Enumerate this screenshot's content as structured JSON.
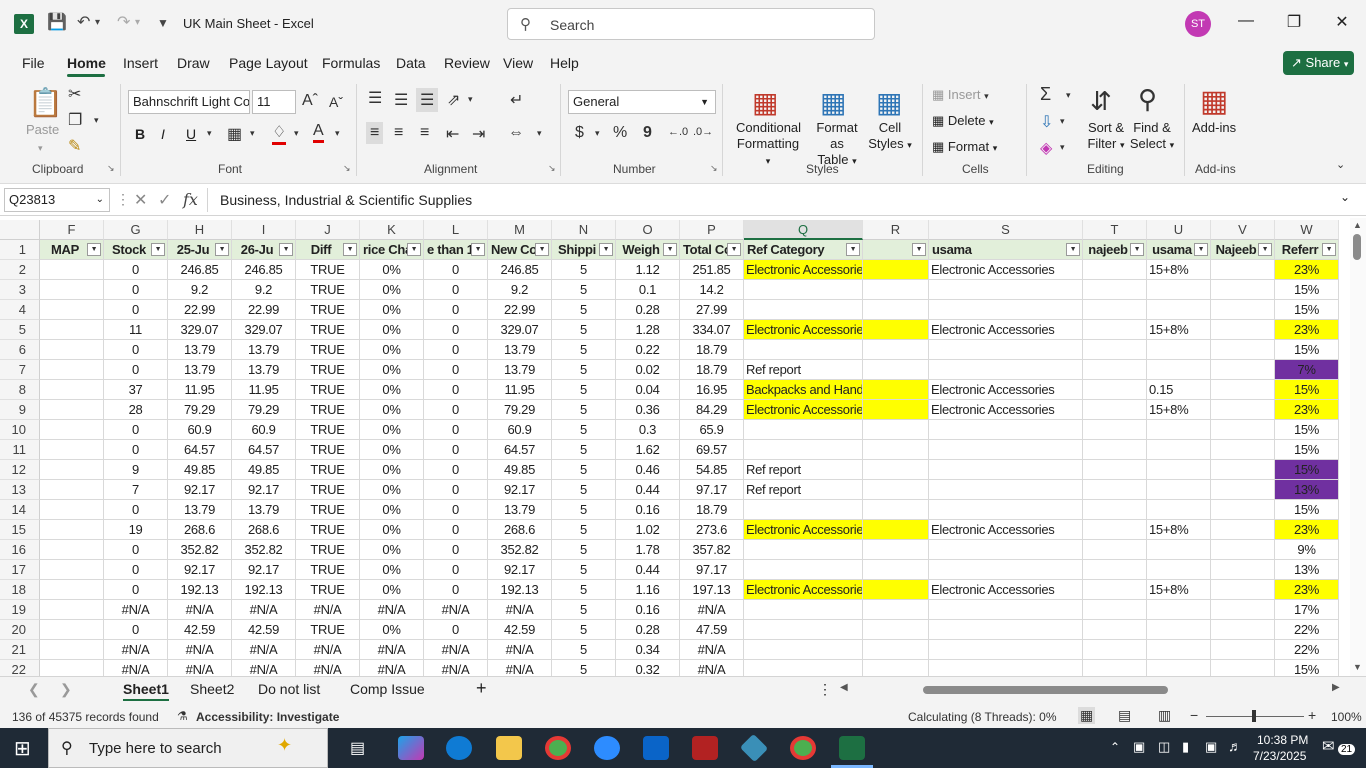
{
  "app": {
    "title": "UK Main Sheet  -  Excel",
    "search_placeholder": "Search",
    "user_initials": "ST",
    "logo": "X"
  },
  "menu": {
    "items": [
      "File",
      "Home",
      "Insert",
      "Draw",
      "Page Layout",
      "Formulas",
      "Data",
      "Review",
      "View",
      "Help"
    ],
    "active": "Home",
    "share_label": "Share"
  },
  "ribbon": {
    "clipboard": {
      "label": "Clipboard",
      "paste": "Paste"
    },
    "font": {
      "label": "Font",
      "font_name": "Bahnschrift Light Co",
      "font_size": "11",
      "bold": "B",
      "italic": "I",
      "underline": "U"
    },
    "alignment": {
      "label": "Alignment"
    },
    "number": {
      "label": "Number",
      "format": "General",
      "currency": "$",
      "percent": "%",
      "comma": "9"
    },
    "styles": {
      "label": "Styles",
      "conditional": "Conditional",
      "conditional2": "Formatting",
      "format_as": "Format as",
      "format_as2": "Table",
      "cell": "Cell",
      "cell2": "Styles"
    },
    "cells": {
      "label": "Cells",
      "insert": "Insert",
      "delete": "Delete",
      "format": "Format"
    },
    "editing": {
      "label": "Editing",
      "sort": "Sort &",
      "sort2": "Filter",
      "find": "Find &",
      "find2": "Select"
    },
    "addins": {
      "label": "Add-ins",
      "button": "Add-ins"
    }
  },
  "formula_bar": {
    "name_box": "Q23813",
    "fx": "fx",
    "value": "Business, Industrial & Scientific Supplies"
  },
  "columns": [
    "F",
    "G",
    "H",
    "I",
    "J",
    "K",
    "L",
    "M",
    "N",
    "O",
    "P",
    "Q",
    "R",
    "S",
    "T",
    "U",
    "V",
    "W"
  ],
  "header_row": [
    "MAP",
    "Stock",
    "25-Ju",
    "26-Ju",
    "Diff",
    "rice Cha",
    "e than 1",
    "New Co",
    "Shippi",
    "Weigh",
    "Total Co",
    "Ref Category",
    "",
    "usama",
    "najeeb",
    "usama",
    "Najeeb",
    "Referr"
  ],
  "rows": [
    {
      "n": "2",
      "cells": [
        "",
        "0",
        "246.85",
        "246.85",
        "TRUE",
        "0%",
        "0",
        "246.85",
        "5",
        "1.12",
        "251.85",
        "Electronic Accessories",
        "",
        "Electronic Accessories",
        "",
        "15+8%",
        "",
        "23%"
      ],
      "q": "yel",
      "r": "yel",
      "w": "yel"
    },
    {
      "n": "3",
      "cells": [
        "",
        "0",
        "9.2",
        "9.2",
        "TRUE",
        "0%",
        "0",
        "9.2",
        "5",
        "0.1",
        "14.2",
        "",
        "",
        "",
        "",
        "",
        "",
        "15%"
      ]
    },
    {
      "n": "4",
      "cells": [
        "",
        "0",
        "22.99",
        "22.99",
        "TRUE",
        "0%",
        "0",
        "22.99",
        "5",
        "0.28",
        "27.99",
        "",
        "",
        "",
        "",
        "",
        "",
        "15%"
      ]
    },
    {
      "n": "5",
      "cells": [
        "",
        "11",
        "329.07",
        "329.07",
        "TRUE",
        "0%",
        "0",
        "329.07",
        "5",
        "1.28",
        "334.07",
        "Electronic Accessories",
        "",
        "Electronic Accessories",
        "",
        "15+8%",
        "",
        "23%"
      ],
      "q": "yel",
      "r": "yel",
      "w": "yel"
    },
    {
      "n": "6",
      "cells": [
        "",
        "0",
        "13.79",
        "13.79",
        "TRUE",
        "0%",
        "0",
        "13.79",
        "5",
        "0.22",
        "18.79",
        "",
        "",
        "",
        "",
        "",
        "",
        "15%"
      ]
    },
    {
      "n": "7",
      "cells": [
        "",
        "0",
        "13.79",
        "13.79",
        "TRUE",
        "0%",
        "0",
        "13.79",
        "5",
        "0.02",
        "18.79",
        "Ref report",
        "",
        "",
        "",
        "",
        "",
        "7%"
      ],
      "w": "pur"
    },
    {
      "n": "8",
      "cells": [
        "",
        "37",
        "11.95",
        "11.95",
        "TRUE",
        "0%",
        "0",
        "11.95",
        "5",
        "0.04",
        "16.95",
        "Backpacks and Handbags",
        "",
        "Electronic Accessories",
        "",
        "0.15",
        "",
        "15%"
      ],
      "q": "yel",
      "r": "yel",
      "w": "yel"
    },
    {
      "n": "9",
      "cells": [
        "",
        "28",
        "79.29",
        "79.29",
        "TRUE",
        "0%",
        "0",
        "79.29",
        "5",
        "0.36",
        "84.29",
        "Electronic Accessories",
        "",
        "Electronic Accessories",
        "",
        "15+8%",
        "",
        "23%"
      ],
      "q": "yel",
      "r": "yel",
      "w": "yel"
    },
    {
      "n": "10",
      "cells": [
        "",
        "0",
        "60.9",
        "60.9",
        "TRUE",
        "0%",
        "0",
        "60.9",
        "5",
        "0.3",
        "65.9",
        "",
        "",
        "",
        "",
        "",
        "",
        "15%"
      ]
    },
    {
      "n": "11",
      "cells": [
        "",
        "0",
        "64.57",
        "64.57",
        "TRUE",
        "0%",
        "0",
        "64.57",
        "5",
        "1.62",
        "69.57",
        "",
        "",
        "",
        "",
        "",
        "",
        "15%"
      ]
    },
    {
      "n": "12",
      "cells": [
        "",
        "9",
        "49.85",
        "49.85",
        "TRUE",
        "0%",
        "0",
        "49.85",
        "5",
        "0.46",
        "54.85",
        "Ref report",
        "",
        "",
        "",
        "",
        "",
        "15%"
      ],
      "w": "pur"
    },
    {
      "n": "13",
      "cells": [
        "",
        "7",
        "92.17",
        "92.17",
        "TRUE",
        "0%",
        "0",
        "92.17",
        "5",
        "0.44",
        "97.17",
        "Ref report",
        "",
        "",
        "",
        "",
        "",
        "13%"
      ],
      "w": "pur"
    },
    {
      "n": "14",
      "cells": [
        "",
        "0",
        "13.79",
        "13.79",
        "TRUE",
        "0%",
        "0",
        "13.79",
        "5",
        "0.16",
        "18.79",
        "",
        "",
        "",
        "",
        "",
        "",
        "15%"
      ]
    },
    {
      "n": "15",
      "cells": [
        "",
        "19",
        "268.6",
        "268.6",
        "TRUE",
        "0%",
        "0",
        "268.6",
        "5",
        "1.02",
        "273.6",
        "Electronic Accessories",
        "",
        "Electronic Accessories",
        "",
        "15+8%",
        "",
        "23%"
      ],
      "q": "yel",
      "r": "yel",
      "w": "yel"
    },
    {
      "n": "16",
      "cells": [
        "",
        "0",
        "352.82",
        "352.82",
        "TRUE",
        "0%",
        "0",
        "352.82",
        "5",
        "1.78",
        "357.82",
        "",
        "",
        "",
        "",
        "",
        "",
        "9%"
      ]
    },
    {
      "n": "17",
      "cells": [
        "",
        "0",
        "92.17",
        "92.17",
        "TRUE",
        "0%",
        "0",
        "92.17",
        "5",
        "0.44",
        "97.17",
        "",
        "",
        "",
        "",
        "",
        "",
        "13%"
      ]
    },
    {
      "n": "18",
      "cells": [
        "",
        "0",
        "192.13",
        "192.13",
        "TRUE",
        "0%",
        "0",
        "192.13",
        "5",
        "1.16",
        "197.13",
        "Electronic Accessories",
        "",
        "Electronic Accessories",
        "",
        "15+8%",
        "",
        "23%"
      ],
      "q": "yel",
      "r": "yel",
      "w": "yel"
    },
    {
      "n": "19",
      "cells": [
        "",
        "#N/A",
        "#N/A",
        "#N/A",
        "#N/A",
        "#N/A",
        "#N/A",
        "#N/A",
        "5",
        "0.16",
        "#N/A",
        "",
        "",
        "",
        "",
        "",
        "",
        "17%"
      ]
    },
    {
      "n": "20",
      "cells": [
        "",
        "0",
        "42.59",
        "42.59",
        "TRUE",
        "0%",
        "0",
        "42.59",
        "5",
        "0.28",
        "47.59",
        "",
        "",
        "",
        "",
        "",
        "",
        "22%"
      ]
    },
    {
      "n": "21",
      "cells": [
        "",
        "#N/A",
        "#N/A",
        "#N/A",
        "#N/A",
        "#N/A",
        "#N/A",
        "#N/A",
        "5",
        "0.34",
        "#N/A",
        "",
        "",
        "",
        "",
        "",
        "",
        "22%"
      ]
    },
    {
      "n": "22",
      "cells": [
        "",
        "#N/A",
        "#N/A",
        "#N/A",
        "#N/A",
        "#N/A",
        "#N/A",
        "#N/A",
        "5",
        "0.32",
        "#N/A",
        "",
        "",
        "",
        "",
        "",
        "",
        "15%"
      ]
    }
  ],
  "sheets": [
    "Sheet1",
    "Sheet2",
    "Do not list",
    "Comp Issue"
  ],
  "active_sheet": "Sheet1",
  "status": {
    "records": "136 of 45375 records found",
    "accessibility": "Accessibility: Investigate",
    "calculating": "Calculating (8 Threads): 0%",
    "zoom": "100%"
  },
  "taskbar": {
    "search_placeholder": "Type here to search",
    "time": "10:38 PM",
    "date": "7/23/2025",
    "notifications": "21"
  },
  "colors": {
    "accent": "#1d6f42",
    "highlight_yellow": "#ffff00",
    "highlight_purple": "#7030a0",
    "header_green": "#e2efda"
  }
}
